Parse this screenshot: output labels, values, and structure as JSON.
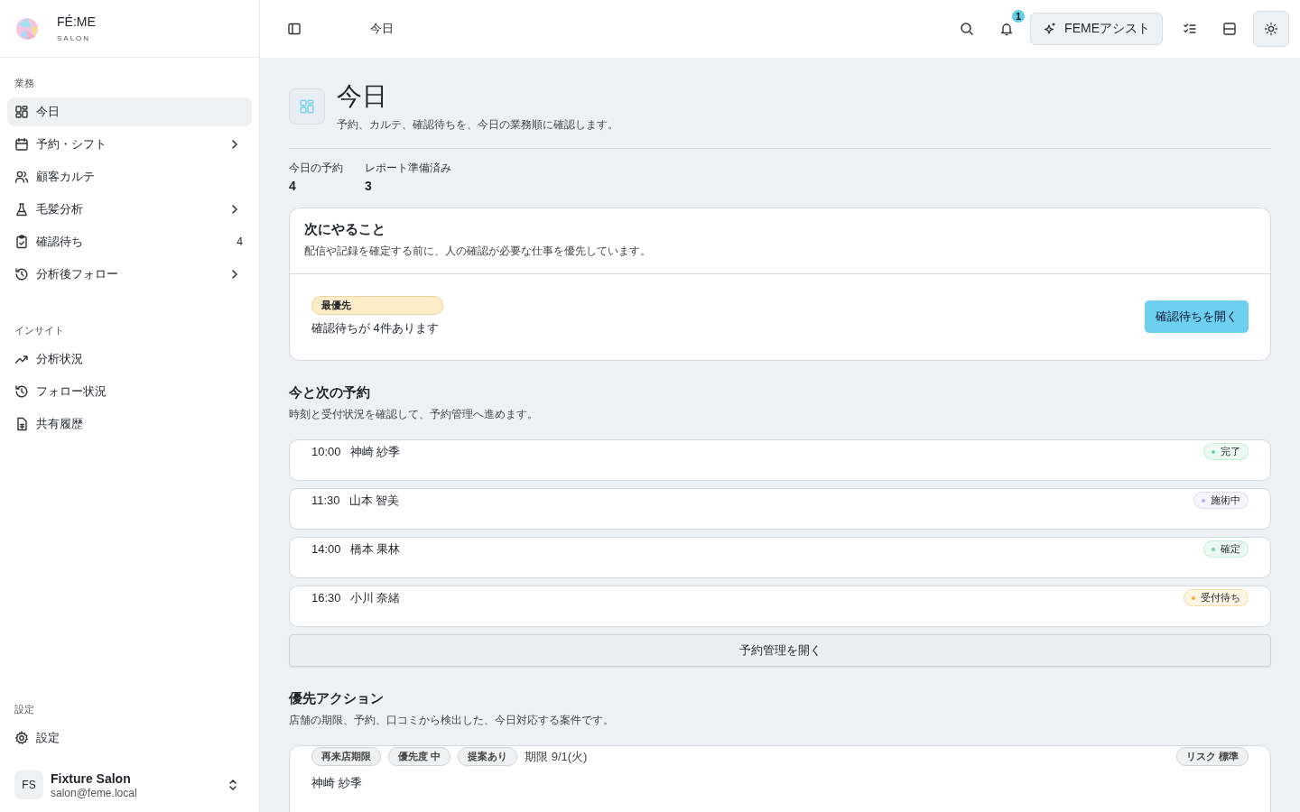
{
  "brand": {
    "name": "FÉ:ME",
    "tagline": "SALON"
  },
  "sidebar": {
    "sections": [
      {
        "title": "業務",
        "items": [
          {
            "label": "今日",
            "selected": true,
            "submenu": false
          },
          {
            "label": "予約・シフト",
            "selected": false,
            "submenu": true
          },
          {
            "label": "顧客カルテ",
            "selected": false,
            "submenu": false
          },
          {
            "label": "毛髪分析",
            "selected": false,
            "submenu": true
          },
          {
            "label": "確認待ち",
            "selected": false,
            "submenu": false,
            "count": "4"
          },
          {
            "label": "分析後フォロー",
            "selected": false,
            "submenu": true
          }
        ]
      },
      {
        "title": "インサイト",
        "items": [
          {
            "label": "分析状況",
            "selected": false,
            "submenu": false
          },
          {
            "label": "フォロー状況",
            "selected": false,
            "submenu": false
          },
          {
            "label": "共有履歴",
            "selected": false,
            "submenu": false
          }
        ]
      }
    ],
    "settings": {
      "title": "設定",
      "items": [
        {
          "label": "設定",
          "selected": false,
          "submenu": false
        }
      ]
    },
    "account": {
      "initials": "FS",
      "name": "Fixture Salon",
      "email": "salon@feme.local"
    }
  },
  "topbar": {
    "title": "今日",
    "notification_count": "1",
    "assist_button": "FEMEアシスト",
    "theme_toggle_on": true
  },
  "page": {
    "title": "今日",
    "subtitle": "予約、カルテ、確認待ちを、今日の業務順に確認します。",
    "stats": [
      {
        "label": "今日の予約",
        "value": "4"
      },
      {
        "label": "レポート準備済み",
        "value": "3"
      }
    ],
    "next": {
      "title": "次にやること",
      "description": "配信や記録を確定する前に、人の確認が必要な仕事を優先しています。",
      "tag": "最優先",
      "message": "確認待ちが 4件あります",
      "button": "確認待ちを開く"
    },
    "appointments": {
      "title": "今と次の予約",
      "description": "時刻と受付状況を確認して、予約管理へ進めます。",
      "rows": [
        {
          "time": "10:00",
          "name": "神崎 紗季",
          "status": "完了",
          "color": "#6fd4a4"
        },
        {
          "time": "11:30",
          "name": "山本 智美",
          "status": "施術中",
          "color": "#b9aef0"
        },
        {
          "time": "14:00",
          "name": "橋本 果林",
          "status": "確定",
          "color": "#6fd4a4"
        },
        {
          "time": "16:30",
          "name": "小川 奈緒",
          "status": "受付待ち",
          "color": "#f2b532"
        }
      ],
      "button": "予約管理を開く"
    },
    "actions": {
      "title": "優先アクション",
      "description": "店舗の期限、予約、口コミから検出した、今日対応する案件です。",
      "items": [
        {
          "tags": [
            "再来店期限",
            "優先度 中",
            "提案あり"
          ],
          "due": "期限 9/1(火)",
          "risk": "リスク 標準",
          "name": "神崎 紗季"
        }
      ]
    }
  }
}
